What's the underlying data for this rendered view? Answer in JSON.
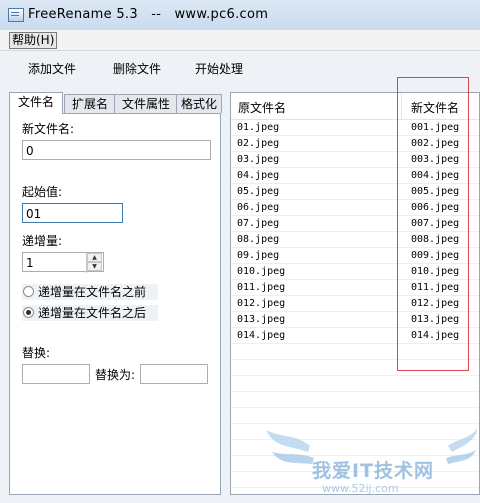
{
  "window": {
    "title": "FreeRename 5.3   --   www.pc6.com"
  },
  "menu": {
    "help": "帮助(H)"
  },
  "toolbar": {
    "add_files": "添加文件",
    "remove_files": "删除文件",
    "start": "开始处理"
  },
  "tabs": [
    {
      "label": "文件名",
      "active": true
    },
    {
      "label": "扩展名",
      "active": false
    },
    {
      "label": "文件属性",
      "active": false
    },
    {
      "label": "格式化",
      "active": false
    }
  ],
  "form": {
    "new_name_label": "新文件名:",
    "new_name_value": "0",
    "start_label": "起始值:",
    "start_value": "01",
    "step_label": "递增量:",
    "step_value": "1",
    "radio_before": "递增量在文件名之前",
    "radio_after": "递增量在文件名之后",
    "radio_selected": "after",
    "replace_label": "替换:",
    "replace_value": "",
    "replace_with_label": "替换为:",
    "replace_with_value": ""
  },
  "list": {
    "headers": [
      "原文件名",
      "新文件名"
    ],
    "rows": [
      [
        "01.jpeg",
        "001.jpeg"
      ],
      [
        "02.jpeg",
        "002.jpeg"
      ],
      [
        "03.jpeg",
        "003.jpeg"
      ],
      [
        "04.jpeg",
        "004.jpeg"
      ],
      [
        "05.jpeg",
        "005.jpeg"
      ],
      [
        "06.jpeg",
        "006.jpeg"
      ],
      [
        "07.jpeg",
        "007.jpeg"
      ],
      [
        "08.jpeg",
        "008.jpeg"
      ],
      [
        "09.jpeg",
        "009.jpeg"
      ],
      [
        "010.jpeg",
        "010.jpeg"
      ],
      [
        "011.jpeg",
        "011.jpeg"
      ],
      [
        "012.jpeg",
        "012.jpeg"
      ],
      [
        "013.jpeg",
        "013.jpeg"
      ],
      [
        "014.jpeg",
        "014.jpeg"
      ]
    ]
  },
  "watermark": {
    "text": "我爱IT技术网",
    "url": "www.52ij.com"
  },
  "colors": {
    "highlight": "#d9454f",
    "titlebar": "#c9dbee"
  }
}
